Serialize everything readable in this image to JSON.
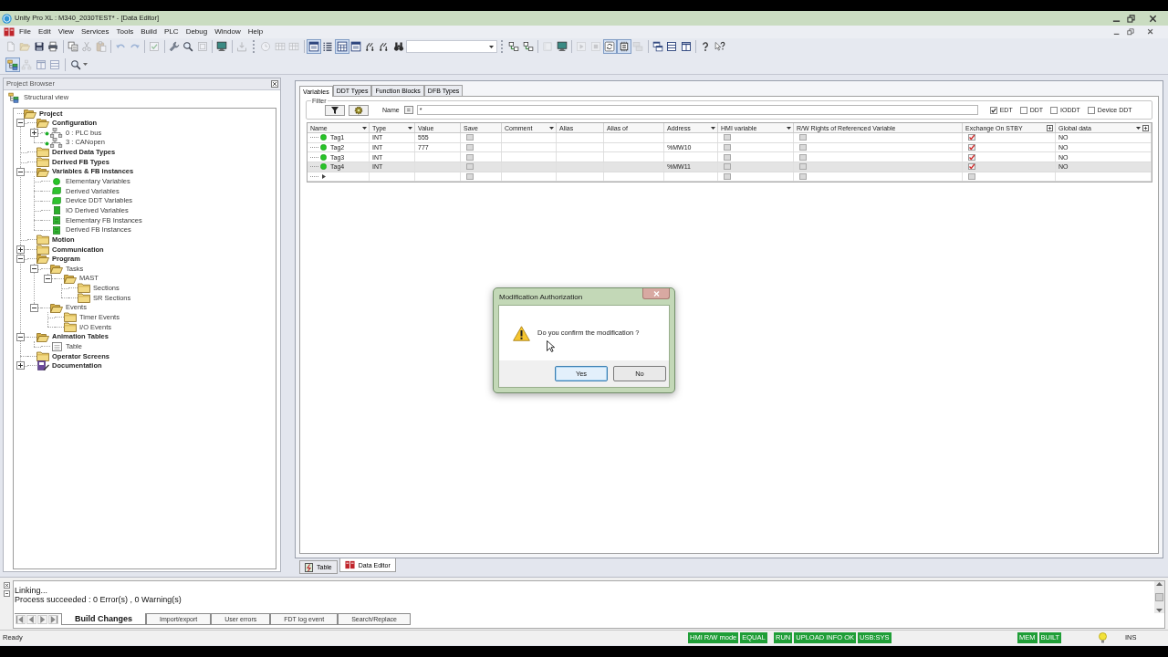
{
  "window": {
    "title": "Unity Pro XL : M340_2030TEST* - [Data Editor]"
  },
  "menu": [
    "File",
    "Edit",
    "View",
    "Services",
    "Tools",
    "Build",
    "PLC",
    "Debug",
    "Window",
    "Help"
  ],
  "toolbars": [
    [
      {
        "kind": "page",
        "pressed": false,
        "disabled": true
      },
      {
        "kind": "open",
        "pressed": false,
        "disabled": true
      },
      {
        "kind": "save",
        "pressed": false,
        "disabled": false
      },
      {
        "kind": "print",
        "pressed": false,
        "disabled": false
      },
      {
        "kind": "separator"
      },
      {
        "kind": "copy",
        "pressed": false,
        "disabled": false
      },
      {
        "kind": "cut",
        "pressed": false,
        "disabled": true
      },
      {
        "kind": "paste",
        "pressed": false,
        "disabled": true
      },
      {
        "kind": "separator"
      },
      {
        "kind": "undo",
        "pressed": false,
        "disabled": true
      },
      {
        "kind": "redo",
        "pressed": false,
        "disabled": true
      },
      {
        "kind": "separator"
      },
      {
        "kind": "validate",
        "pressed": false,
        "disabled": true
      },
      {
        "kind": "separator"
      },
      {
        "kind": "wrench",
        "pressed": false,
        "disabled": false
      },
      {
        "kind": "magnifier",
        "pressed": false,
        "disabled": false
      },
      {
        "kind": "frame",
        "pressed": false,
        "disabled": true
      },
      {
        "kind": "separator"
      },
      {
        "kind": "monitor",
        "pressed": false,
        "disabled": false
      },
      {
        "kind": "separator"
      },
      {
        "kind": "download",
        "pressed": false,
        "disabled": true
      },
      {
        "kind": "grip"
      },
      {
        "kind": "clock",
        "pressed": false,
        "disabled": true
      },
      {
        "kind": "grid",
        "pressed": false,
        "disabled": true
      },
      {
        "kind": "grid",
        "pressed": false,
        "disabled": true
      },
      {
        "kind": "separator"
      },
      {
        "kind": "window",
        "pressed": true,
        "disabled": false
      },
      {
        "kind": "list",
        "pressed": false,
        "disabled": false
      },
      {
        "kind": "table",
        "pressed": true,
        "disabled": false
      },
      {
        "kind": "window",
        "pressed": false,
        "disabled": false
      },
      {
        "kind": "fork",
        "pressed": false,
        "disabled": false
      },
      {
        "kind": "fork",
        "pressed": false,
        "disabled": false
      },
      {
        "kind": "binoculars",
        "pressed": false,
        "disabled": false
      },
      {
        "kind": "combo"
      },
      {
        "kind": "grip"
      },
      {
        "kind": "link",
        "pressed": false,
        "disabled": false
      },
      {
        "kind": "link",
        "pressed": false,
        "disabled": false
      },
      {
        "kind": "separator"
      },
      {
        "kind": "panel",
        "pressed": false,
        "disabled": true
      },
      {
        "kind": "monitor",
        "pressed": false,
        "disabled": false
      },
      {
        "kind": "separator"
      },
      {
        "kind": "play",
        "pressed": false,
        "disabled": true
      },
      {
        "kind": "stop",
        "pressed": false,
        "disabled": true
      },
      {
        "kind": "cycle",
        "pressed": true,
        "disabled": false
      },
      {
        "kind": "chip",
        "pressed": true,
        "disabled": false
      },
      {
        "kind": "stack",
        "pressed": false,
        "disabled": true
      },
      {
        "kind": "separator"
      },
      {
        "kind": "cascade",
        "pressed": false,
        "disabled": false
      },
      {
        "kind": "rows",
        "pressed": false,
        "disabled": false
      },
      {
        "kind": "columns",
        "pressed": false,
        "disabled": false
      },
      {
        "kind": "separator"
      },
      {
        "kind": "help",
        "pressed": false,
        "disabled": false
      },
      {
        "kind": "context-help",
        "pressed": false,
        "disabled": false
      }
    ],
    [
      {
        "kind": "tree",
        "pressed": true,
        "disabled": false
      },
      {
        "kind": "hierarchy",
        "pressed": false,
        "disabled": true
      },
      {
        "kind": "columns",
        "pressed": false,
        "disabled": true
      },
      {
        "kind": "rows",
        "pressed": false,
        "disabled": true
      },
      {
        "kind": "separator"
      },
      {
        "kind": "zoom",
        "pressed": false,
        "disabled": false
      }
    ]
  ],
  "project_browser": {
    "title": "Project Browser",
    "view": "Structural view",
    "tree": {
      "label": "Project",
      "kind": "open-folder",
      "children": [
        {
          "label": "Configuration",
          "kind": "open-folder",
          "expanded": true,
          "children": [
            {
              "label": "0 : PLC bus",
              "kind": "network",
              "expanded": false
            },
            {
              "label": "3 : CANopen",
              "kind": "network"
            }
          ]
        },
        {
          "label": "Derived Data Types",
          "kind": "folder"
        },
        {
          "label": "Derived FB Types",
          "kind": "folder"
        },
        {
          "label": "Variables & FB instances",
          "kind": "open-folder",
          "expanded": true,
          "children": [
            {
              "label": "Elementary Variables",
              "kind": "variable"
            },
            {
              "label": "Derived Variables",
              "kind": "derived-variable"
            },
            {
              "label": "Device DDT Variables",
              "kind": "derived-variable"
            },
            {
              "label": "IO Derived Variables",
              "kind": "io-variable"
            },
            {
              "label": "Elementary FB Instances",
              "kind": "fb-instance"
            },
            {
              "label": "Derived FB Instances",
              "kind": "fb-instance"
            }
          ]
        },
        {
          "label": "Motion",
          "kind": "folder"
        },
        {
          "label": "Communication",
          "kind": "folder",
          "expanded": false
        },
        {
          "label": "Program",
          "kind": "open-folder",
          "expanded": true,
          "children": [
            {
              "label": "Tasks",
              "kind": "open-folder",
              "expanded": true,
              "children": [
                {
                  "label": "MAST",
                  "kind": "open-folder",
                  "expanded": true,
                  "children": [
                    {
                      "label": "Sections",
                      "kind": "folder"
                    },
                    {
                      "label": "SR Sections",
                      "kind": "folder"
                    }
                  ]
                }
              ]
            },
            {
              "label": "Events",
              "kind": "open-folder",
              "expanded": true,
              "children": [
                {
                  "label": "Timer Events",
                  "kind": "folder"
                },
                {
                  "label": "I/O Events",
                  "kind": "folder"
                }
              ]
            }
          ]
        },
        {
          "label": "Animation Tables",
          "kind": "open-folder",
          "expanded": true,
          "children": [
            {
              "label": "Table",
              "kind": "table"
            }
          ]
        },
        {
          "label": "Operator Screens",
          "kind": "folder"
        },
        {
          "label": "Documentation",
          "kind": "book",
          "expanded": false
        }
      ]
    }
  },
  "data_editor": {
    "tabs": [
      {
        "label": "Variables",
        "selected": true
      },
      {
        "label": "DDT Types",
        "selected": false
      },
      {
        "label": "Function Blocks",
        "selected": false
      },
      {
        "label": "DFB Types",
        "selected": false
      }
    ],
    "filter": {
      "label": "Filter",
      "name_label": "Name",
      "operator": "=",
      "name_value": "*",
      "types": [
        {
          "label": "EDT",
          "checked": true
        },
        {
          "label": "DDT",
          "checked": false
        },
        {
          "label": "IODDT",
          "checked": false
        },
        {
          "label": "Device DDT",
          "checked": false
        }
      ]
    },
    "table": {
      "columns": [
        {
          "label": "Name",
          "menu": true,
          "expand": false
        },
        {
          "label": "Type",
          "menu": true,
          "expand": false
        },
        {
          "label": "Value",
          "menu": false,
          "expand": false
        },
        {
          "label": "Save",
          "menu": false,
          "expand": false
        },
        {
          "label": "Comment",
          "menu": true,
          "expand": false
        },
        {
          "label": "Alias",
          "menu": false,
          "expand": false
        },
        {
          "label": "Alias of",
          "menu": false,
          "expand": false
        },
        {
          "label": "Address",
          "menu": true,
          "expand": false
        },
        {
          "label": "HMI variable",
          "menu": true,
          "expand": false
        },
        {
          "label": "R/W Rights of Referenced Variable",
          "menu": false,
          "expand": false
        },
        {
          "label": "Exchange On STBY",
          "menu": false,
          "expand": true
        },
        {
          "label": "Global data",
          "menu": true,
          "expand": true
        }
      ],
      "rows": [
        {
          "kind": "variable",
          "name": "Tag1",
          "type": "INT",
          "value": "555",
          "save": false,
          "hmi_variable": false,
          "rw_rights": false,
          "exchange_on_stby": true,
          "global_data": "NO",
          "selected": false
        },
        {
          "kind": "variable",
          "name": "Tag2",
          "type": "INT",
          "value": "777",
          "save": false,
          "address": "%MW10",
          "hmi_variable": false,
          "rw_rights": false,
          "exchange_on_stby": true,
          "global_data": "NO",
          "selected": false
        },
        {
          "kind": "variable",
          "name": "Tag3",
          "type": "INT",
          "save": false,
          "hmi_variable": false,
          "rw_rights": false,
          "exchange_on_stby": true,
          "global_data": "NO",
          "selected": false
        },
        {
          "kind": "variable",
          "name": "Tag4",
          "type": "INT",
          "save": false,
          "address": "%MW11",
          "hmi_variable": false,
          "rw_rights": false,
          "exchange_on_stby": true,
          "global_data": "NO",
          "selected": true
        },
        {
          "kind": "new",
          "save": false,
          "hmi_variable": false,
          "rw_rights": false,
          "exchange_on_stby": false,
          "selected": false
        }
      ]
    },
    "windows": [
      {
        "label": "Table",
        "kind": "table",
        "selected": false
      },
      {
        "label": "Data Editor",
        "kind": "editor",
        "selected": true
      }
    ]
  },
  "dialog": {
    "title": "Modification Authorization",
    "message": "Do you confirm the modification ?",
    "buttons": [
      {
        "label": "Yes",
        "focused": true
      },
      {
        "label": "No",
        "focused": false
      }
    ]
  },
  "output": {
    "lines": [
      "Linking...",
      "Process succeeded : 0 Error(s) , 0 Warning(s)"
    ],
    "tabs": [
      {
        "label": "Build Changes",
        "selected": true
      },
      {
        "label": "Import/export",
        "selected": false
      },
      {
        "label": "User errors",
        "selected": false
      },
      {
        "label": "FDT log event",
        "selected": false
      },
      {
        "label": "Search/Replace",
        "selected": false
      }
    ]
  },
  "status_bar": {
    "message": "Ready",
    "indicators": [
      [
        "HMI R/W mode",
        "EQUAL"
      ],
      [
        "RUN",
        "UPLOAD INFO OK",
        "USB:SYS"
      ],
      [
        "MEM",
        "BUILT"
      ]
    ],
    "mode": "INS"
  }
}
